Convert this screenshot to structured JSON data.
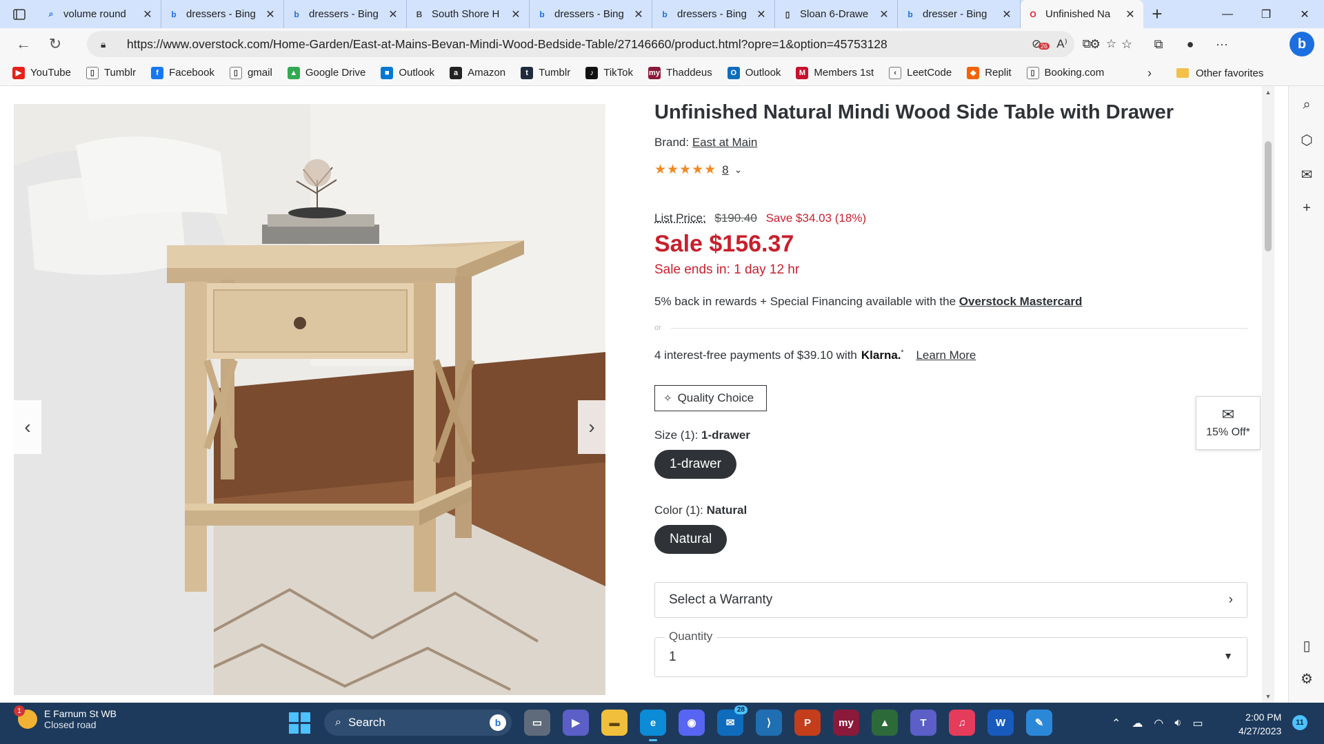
{
  "browser": {
    "tabs": [
      {
        "title": "volume round",
        "icon": "search-icon"
      },
      {
        "title": "dressers - Bing",
        "icon": "bing-icon"
      },
      {
        "title": "dressers - Bing",
        "icon": "bing-icon"
      },
      {
        "title": "South Shore H",
        "icon": "b-icon"
      },
      {
        "title": "dressers - Bing",
        "icon": "bing-icon"
      },
      {
        "title": "dressers - Bing",
        "icon": "bing-icon"
      },
      {
        "title": "Sloan 6-Drawe",
        "icon": "page-icon"
      },
      {
        "title": "dresser - Bing",
        "icon": "bing-icon"
      },
      {
        "title": "Unfinished Na",
        "icon": "overstock-icon",
        "active": true
      }
    ],
    "url": "https://www.overstock.com/Home-Garden/East-at-Mains-Bevan-Mindi-Wood-Bedside-Table/27146660/product.html?opre=1&option=45753128",
    "tracker_count": "26",
    "favorites": [
      {
        "label": "YouTube",
        "color": "#e62117",
        "glyph": "▶"
      },
      {
        "label": "Tumblr",
        "color": "#ffffff",
        "glyph": "▯"
      },
      {
        "label": "Facebook",
        "color": "#1877f2",
        "glyph": "f"
      },
      {
        "label": "gmail",
        "color": "#ffffff",
        "glyph": "▯"
      },
      {
        "label": "Google Drive",
        "color": "#34a853",
        "glyph": "▲"
      },
      {
        "label": "Outlook",
        "color": "#0078d4",
        "glyph": "■"
      },
      {
        "label": "Amazon",
        "color": "#222222",
        "glyph": "a"
      },
      {
        "label": "Tumblr",
        "color": "#1d2b3c",
        "glyph": "t"
      },
      {
        "label": "TikTok",
        "color": "#111111",
        "glyph": "♪"
      },
      {
        "label": "Thaddeus",
        "color": "#8b1a3a",
        "glyph": "my"
      },
      {
        "label": "Outlook",
        "color": "#0f6cbd",
        "glyph": "O"
      },
      {
        "label": "Members 1st",
        "color": "#c8102e",
        "glyph": "M"
      },
      {
        "label": "LeetCode",
        "color": "#f7f7f7",
        "glyph": "‹"
      },
      {
        "label": "Replit",
        "color": "#f26207",
        "glyph": "◆"
      },
      {
        "label": "Booking.com",
        "color": "#ffffff",
        "glyph": "▯"
      }
    ],
    "other_favorites": "Other favorites"
  },
  "product": {
    "title": "Unfinished Natural Mindi Wood Side Table with Drawer",
    "brand_label": "Brand:",
    "brand": "East at Main",
    "rating_stars": "★★★★★",
    "rating": 4.5,
    "review_count": "8",
    "list_price_label": "List Price:",
    "list_price": "$190.40",
    "savings": "Save $34.03 (18%)",
    "sale_price": "Sale $156.37",
    "sale_ends": "Sale ends in: 1 day 12 hr",
    "rewards_text": "5% back in rewards + Special Financing available with the",
    "rewards_link": "Overstock Mastercard",
    "or": "or",
    "klarna_text": "4 interest-free payments of $39.10 with",
    "klarna_brand": "Klarna.",
    "klarna_sup": "*",
    "learn_more": "Learn More",
    "quality_badge": "Quality Choice",
    "size_label": "Size (1):",
    "size_value": "1-drawer",
    "size_option": "1-drawer",
    "color_label": "Color (1):",
    "color_value": "Natural",
    "color_option": "Natural",
    "warranty": "Select a Warranty",
    "quantity_label": "Quantity",
    "quantity": "1",
    "offer": "15% Off*",
    "accent_color": "#c7202c"
  },
  "taskbar": {
    "weather_badge": "1",
    "weather_line1": "E Farnum St WB",
    "weather_line2": "Closed road",
    "search_label": "Search",
    "mail_badge": "28",
    "time": "2:00 PM",
    "date": "4/27/2023",
    "notification_count": "11"
  }
}
